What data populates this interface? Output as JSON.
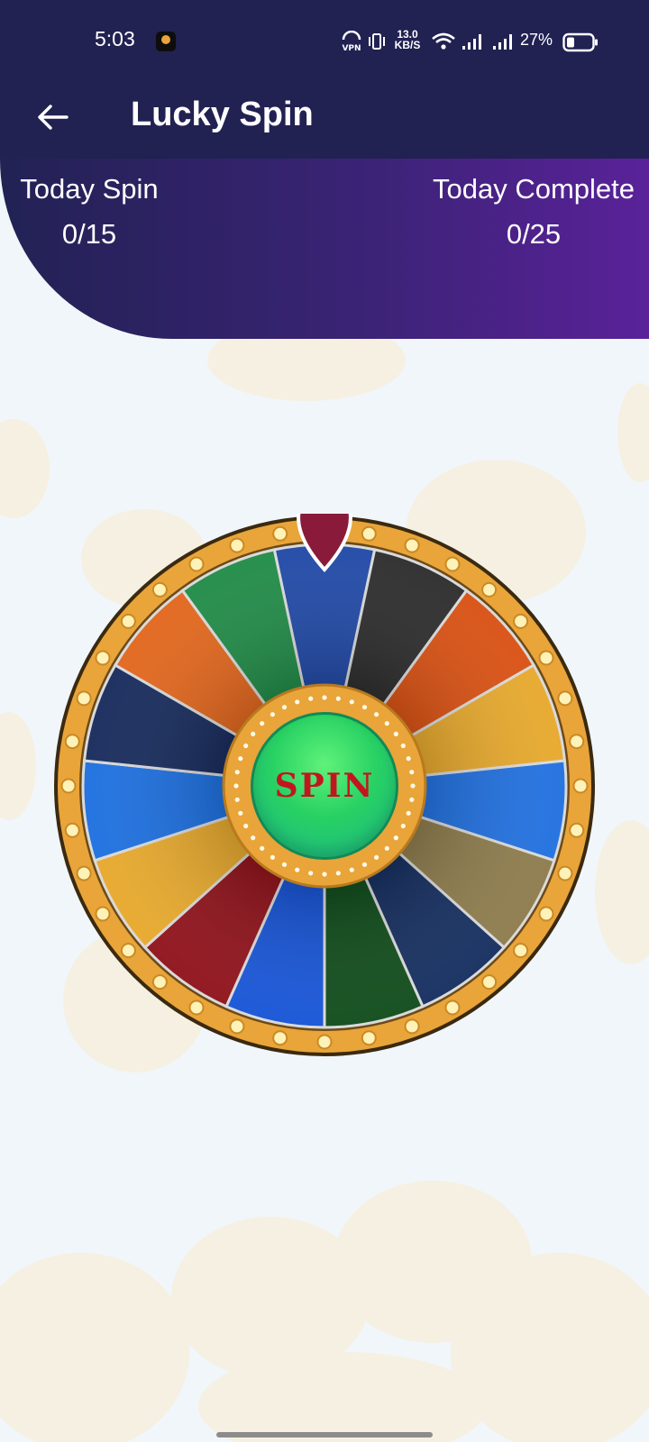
{
  "status_bar": {
    "time": "5:03",
    "speed_value": "13.0",
    "speed_unit": "KB/S",
    "vpn_label": "VPN",
    "battery": "27%"
  },
  "app_bar": {
    "title": "Lucky Spin",
    "back_icon": "arrow-left-icon"
  },
  "stats": {
    "today_spin_label": "Today Spin",
    "today_spin_value": "0/15",
    "today_complete_label": "Today Complete",
    "today_complete_value": "0/25"
  },
  "wheel": {
    "button_label": "SPIN",
    "segment_colors": [
      "#1e47a6",
      "#2a2a2a",
      "#d94f10",
      "#e7a82a",
      "#1e6fe0",
      "#8c7a4a",
      "#122c5e",
      "#0d4a18",
      "#1452d6",
      "#8e0f18",
      "#e7a82a",
      "#1a6ee0",
      "#14285a",
      "#e2651a",
      "#1e8a45"
    ],
    "rim_color": "#e9a43a"
  },
  "colors": {
    "header": "#212152",
    "gradient_end": "#5a2299",
    "background": "#f1f6fb"
  }
}
